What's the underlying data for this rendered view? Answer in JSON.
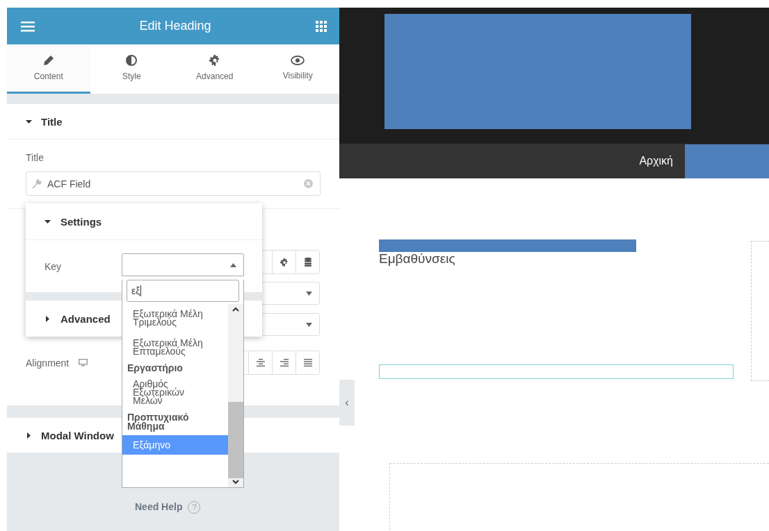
{
  "panel": {
    "title": "Edit Heading",
    "tabs": [
      {
        "label": "Content",
        "selected": true
      },
      {
        "label": "Style",
        "selected": false
      },
      {
        "label": "Advanced",
        "selected": false
      },
      {
        "label": "Visibility",
        "selected": false
      }
    ],
    "title_section": {
      "heading": "Title",
      "expanded": true,
      "field_label": "Title",
      "field_value": "ACF Field"
    },
    "alignment_label": "Alignment",
    "modal_section": {
      "heading": "Modal Window",
      "expanded": false
    },
    "need_help": "Need Help",
    "help_mark": "?"
  },
  "popup": {
    "sections": [
      {
        "heading": "Settings",
        "expanded": true
      },
      {
        "heading": "Advanced",
        "expanded": false
      }
    ],
    "key_label": "Key"
  },
  "dropdown": {
    "search_value": "εξ",
    "options": [
      {
        "kind": "option",
        "label": "Εξωτερικά Μέλη Τριμελούς",
        "selected": false
      },
      {
        "kind": "option",
        "label": "Εξωτερικά Μέλη Επταμελούς",
        "selected": false
      },
      {
        "kind": "group",
        "label": "Εργαστήριο"
      },
      {
        "kind": "option",
        "label": "Αριθμός Εξωτερικών Μελών",
        "selected": false
      },
      {
        "kind": "group",
        "label": "Προπτυχιακό Μάθημα"
      },
      {
        "kind": "option",
        "label": "Εξάμηνο",
        "selected": true
      }
    ]
  },
  "preview": {
    "nav_item": "Αρχική",
    "heading": "Εμβαθύνσεις",
    "collapse_mark": "‹"
  }
}
